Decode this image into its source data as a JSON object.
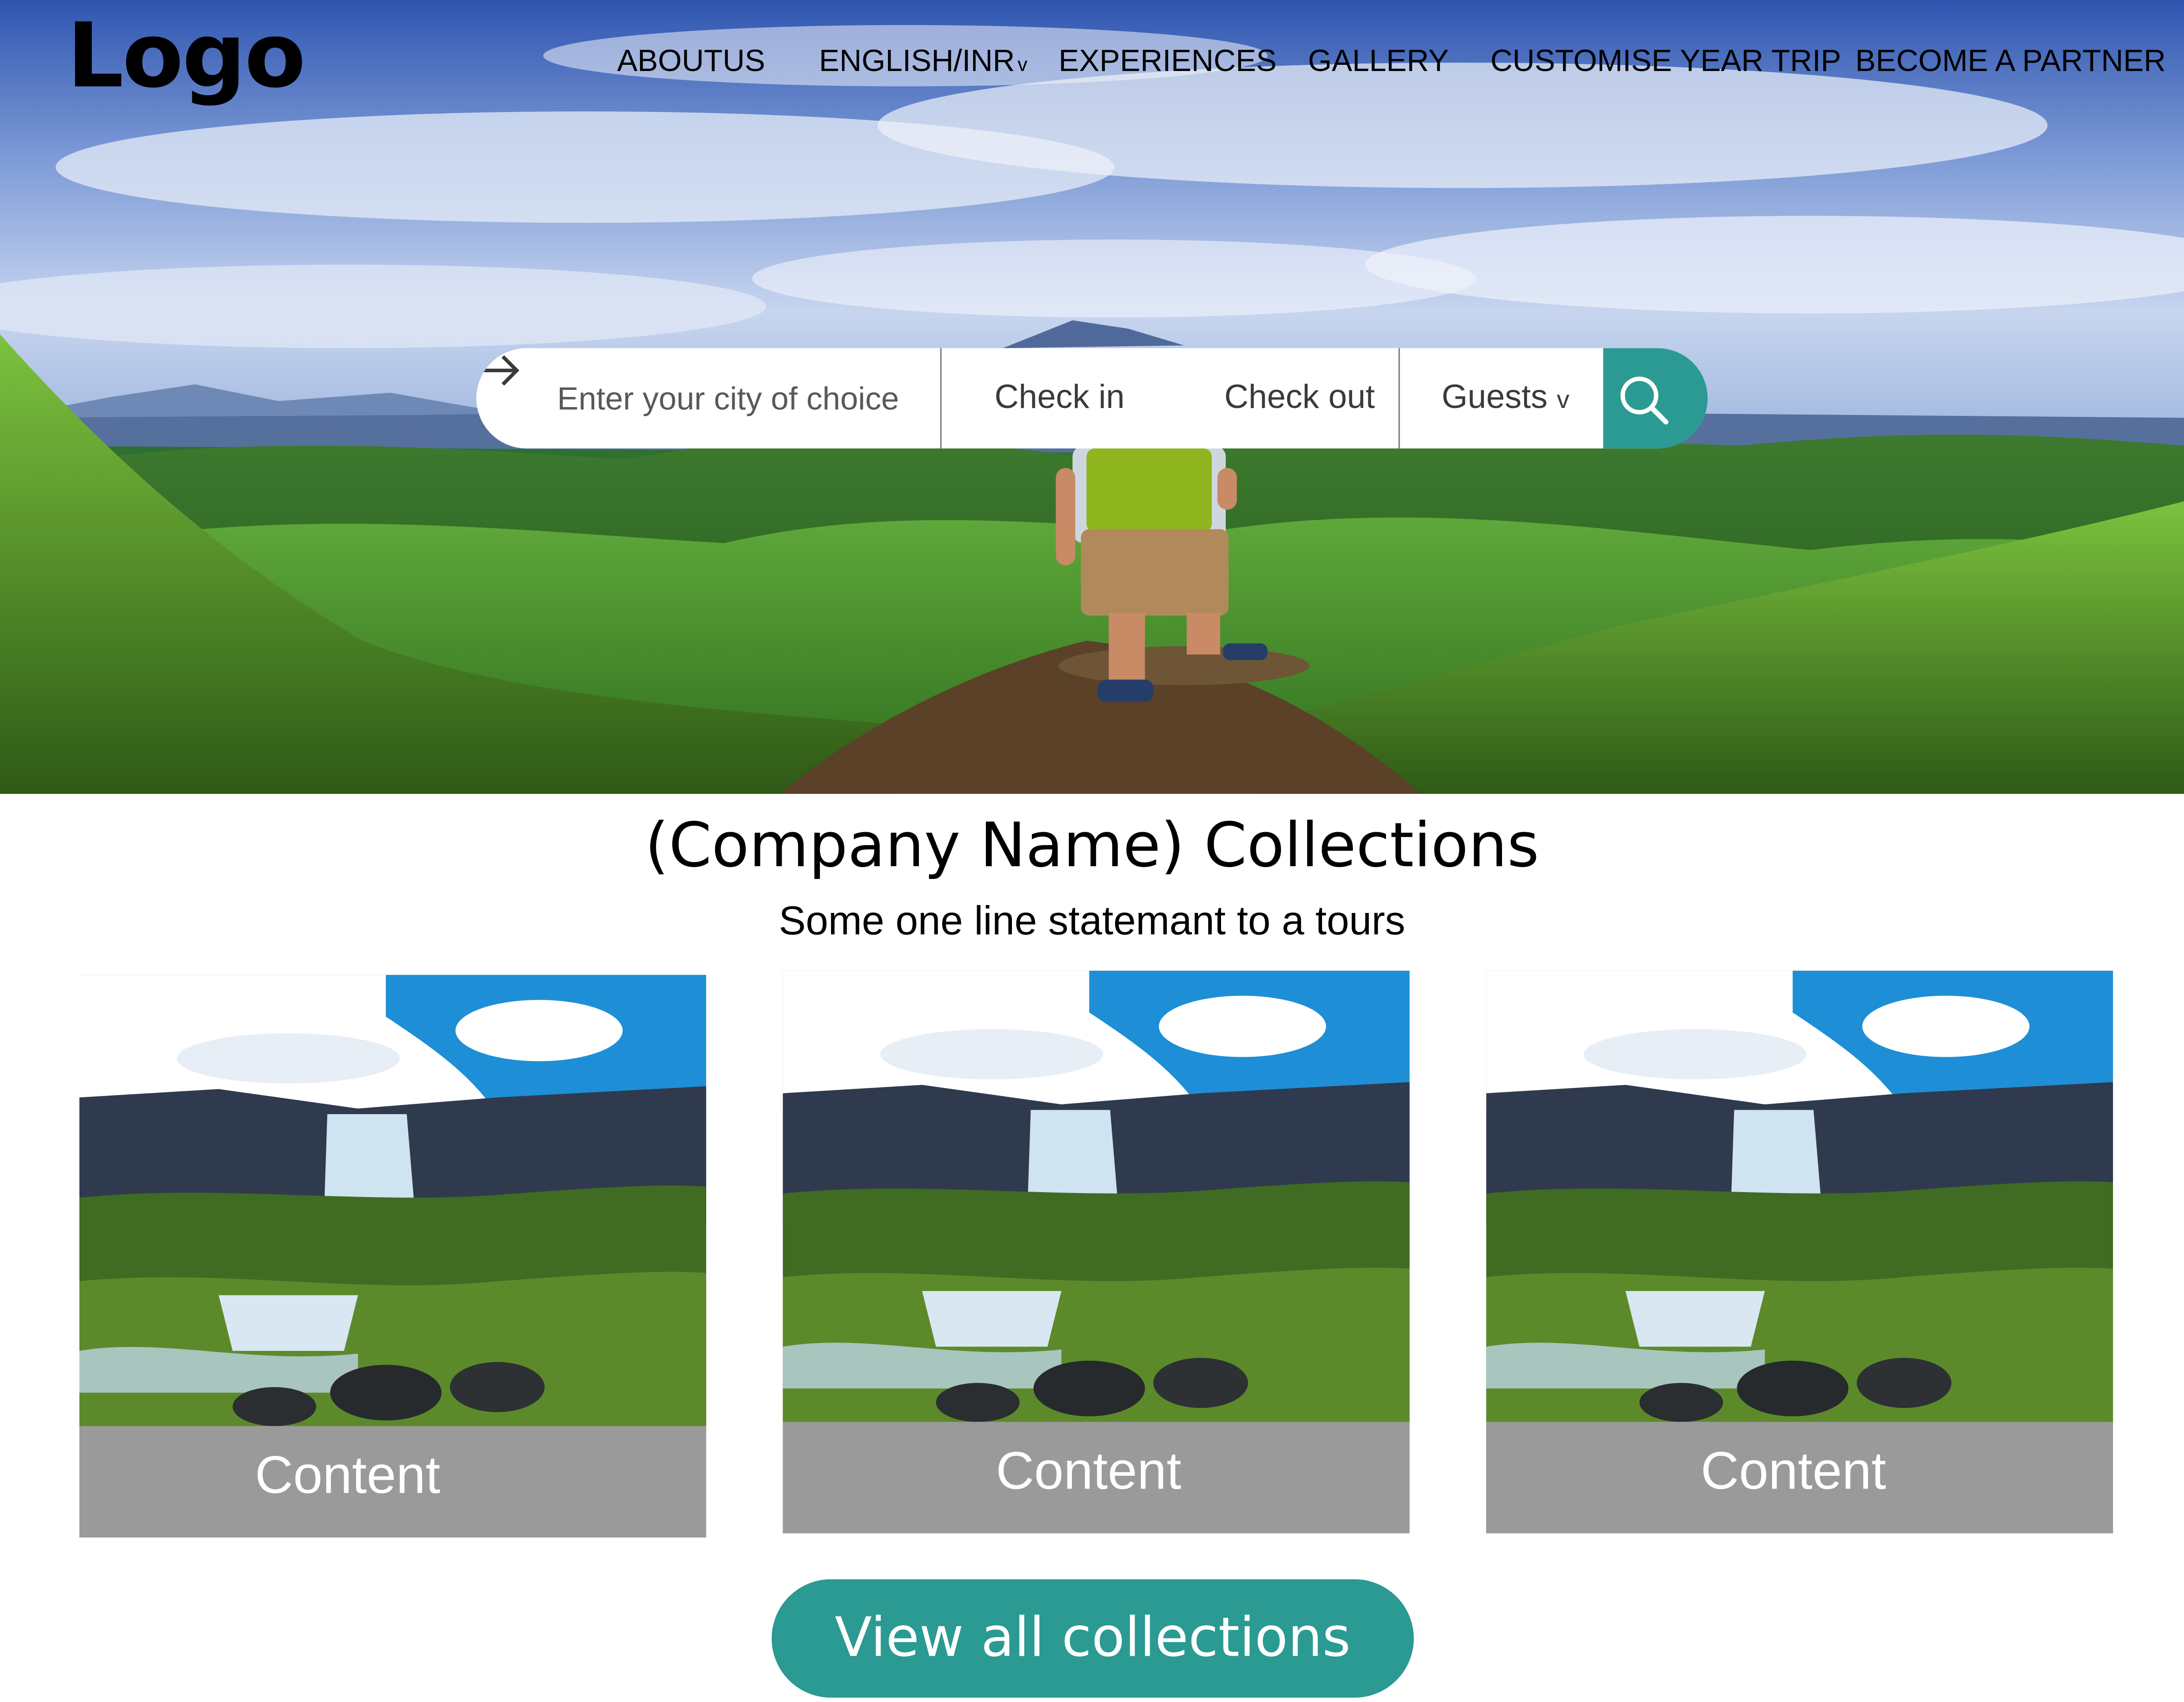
{
  "header": {
    "logo": "Logo",
    "nav": [
      {
        "label": "ABOUTUS"
      },
      {
        "label": "ENGLISH/INR",
        "chevron": "v"
      },
      {
        "label": "EXPERIENCES"
      },
      {
        "label": "GALLERY"
      },
      {
        "label": "CUSTOMISE YEAR TRIP"
      },
      {
        "label": "BECOME A PARTNER"
      }
    ]
  },
  "search": {
    "placeholder": "Enter your city of choice",
    "check_in": "Check in",
    "check_out": "Check out",
    "guests": "Guests",
    "guests_chevron": "v",
    "button_icon": "search-icon"
  },
  "collections": {
    "title": "(Company Name) Collections",
    "subtitle": "Some one line statemant to a tours",
    "cards": [
      {
        "label": "Content",
        "image": "waterfall-landscape"
      },
      {
        "label": "Content",
        "image": "waterfall-landscape"
      },
      {
        "label": "Content",
        "image": "waterfall-landscape"
      }
    ],
    "cta": "View all collections"
  },
  "colors": {
    "accent": "#2a9a92",
    "card_label_bg": "#9a9a9a",
    "nav_text": "#000000"
  }
}
